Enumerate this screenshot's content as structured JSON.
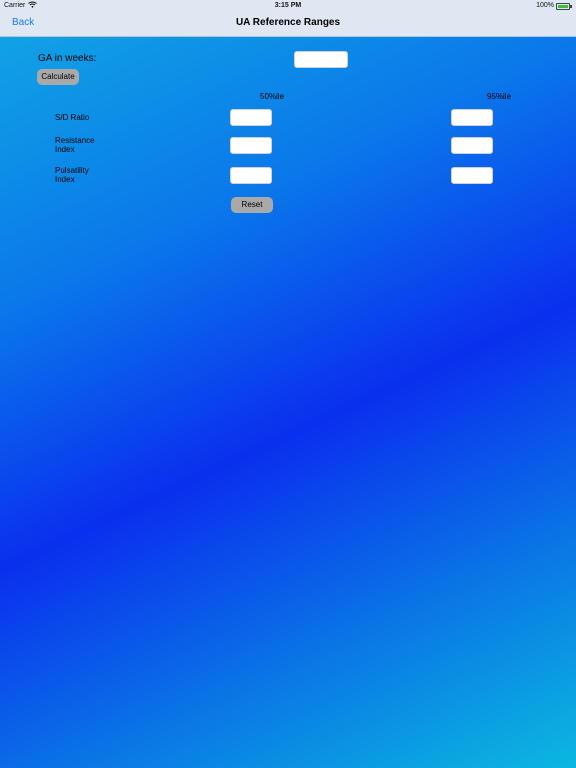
{
  "status_bar": {
    "carrier": "Carrier",
    "time": "3:15 PM",
    "battery": "100%",
    "battery_level": 1.0
  },
  "nav": {
    "back_label": "Back",
    "title": "UA Reference Ranges"
  },
  "form": {
    "ga_label": "GA in weeks:",
    "ga_value": "",
    "calculate_label": "Calculate",
    "col_50_label": "50%ile",
    "col_95_label": "95%ile",
    "rows": [
      {
        "label": "S/D Ratio",
        "p50": "",
        "p95": ""
      },
      {
        "label": "Resistance\nIndex",
        "p50": "",
        "p95": ""
      },
      {
        "label": "Pulsatility\nIndex",
        "p50": "",
        "p95": ""
      }
    ],
    "reset_label": "Reset"
  }
}
